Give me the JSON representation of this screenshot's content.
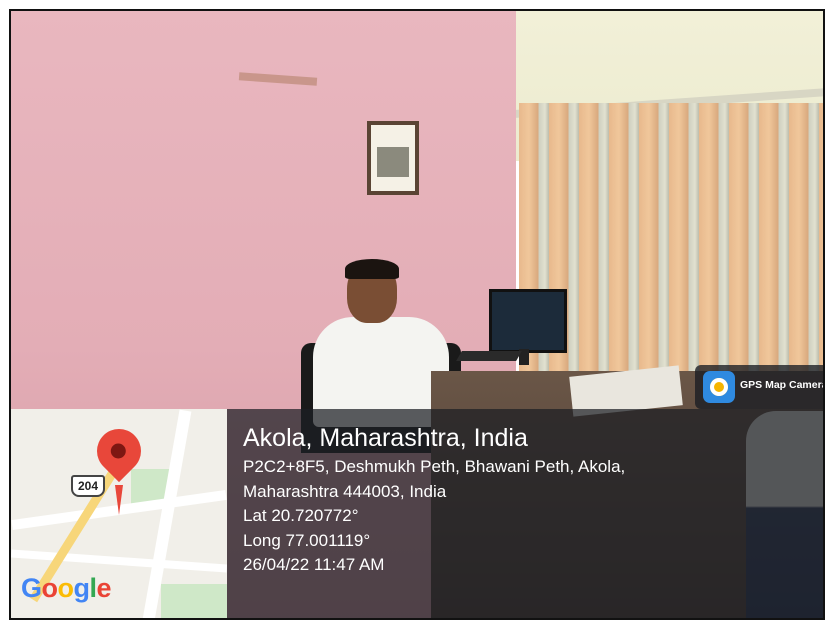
{
  "overlay": {
    "app_badge": {
      "label": "GPS Map Camera",
      "icon": "gps-map-camera-app-icon"
    },
    "location": {
      "title": "Akola, Maharashtra, India",
      "address_line_1": "P2C2+8F5, Deshmukh Peth, Bhawani Peth, Akola,",
      "address_line_2": "Maharashtra 444003, India",
      "latitude": "Lat 20.720772°",
      "longitude": "Long 77.001119°",
      "timestamp": "26/04/22 11:47 AM"
    },
    "map": {
      "route_number": "204",
      "provider_logo": "Google",
      "logo_letters": [
        {
          "char": "G",
          "color": "#4285F4"
        },
        {
          "char": "o",
          "color": "#EA4335"
        },
        {
          "char": "o",
          "color": "#FBBC05"
        },
        {
          "char": "g",
          "color": "#4285F4"
        },
        {
          "char": "l",
          "color": "#34A853"
        },
        {
          "char": "e",
          "color": "#EA4335"
        }
      ],
      "pin_color": "#E8473A"
    }
  }
}
